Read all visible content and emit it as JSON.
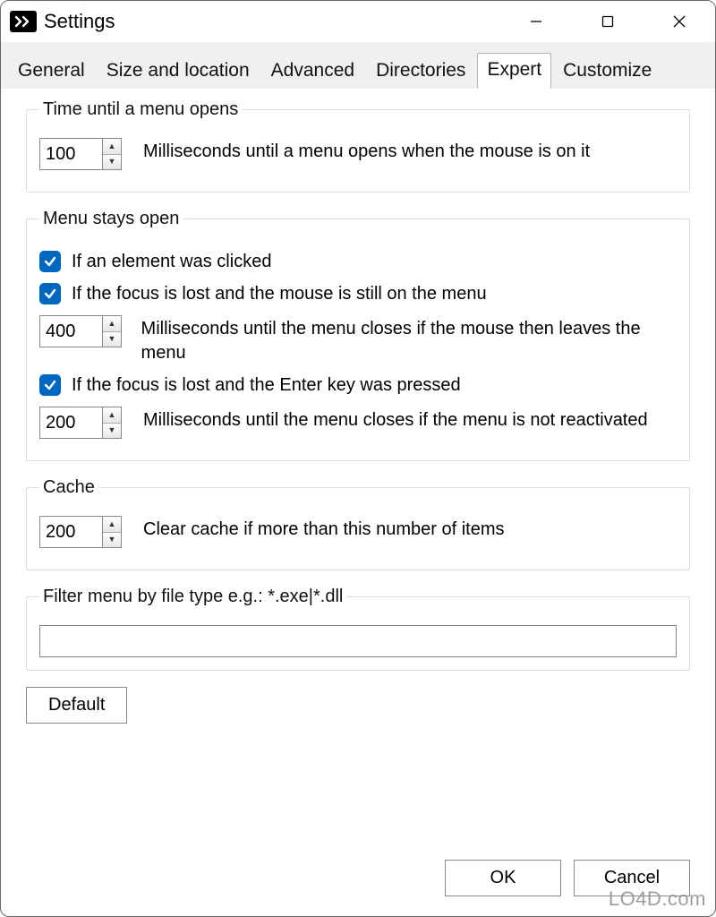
{
  "window": {
    "title": "Settings"
  },
  "tabs": [
    {
      "label": "General"
    },
    {
      "label": "Size and location"
    },
    {
      "label": "Advanced"
    },
    {
      "label": "Directories"
    },
    {
      "label": "Expert",
      "active": true
    },
    {
      "label": "Customize"
    }
  ],
  "groups": {
    "menu_open_time": {
      "legend": "Time until a menu opens",
      "value": "100",
      "desc": "Milliseconds until a menu opens when the mouse is on it"
    },
    "menu_stays_open": {
      "legend": "Menu stays open",
      "check_clicked": {
        "checked": true,
        "label": "If an element was clicked"
      },
      "check_focus_lost_mouse": {
        "checked": true,
        "label": "If the focus is lost and the mouse is still on the menu"
      },
      "close_mouse_leave": {
        "value": "400",
        "desc": "Milliseconds until the menu closes if the mouse then leaves the menu"
      },
      "check_focus_lost_enter": {
        "checked": true,
        "label": "If the focus is lost and the Enter key was pressed"
      },
      "close_not_reactivated": {
        "value": "200",
        "desc": "Milliseconds until the menu closes if the menu is not reactivated"
      }
    },
    "cache": {
      "legend": "Cache",
      "value": "200",
      "desc": "Clear cache if more than this number of items"
    },
    "filter": {
      "legend": "Filter menu by file type e.g.: *.exe|*.dll",
      "value": ""
    }
  },
  "buttons": {
    "default": "Default",
    "ok": "OK",
    "cancel": "Cancel"
  },
  "watermark": "LO4D.com"
}
